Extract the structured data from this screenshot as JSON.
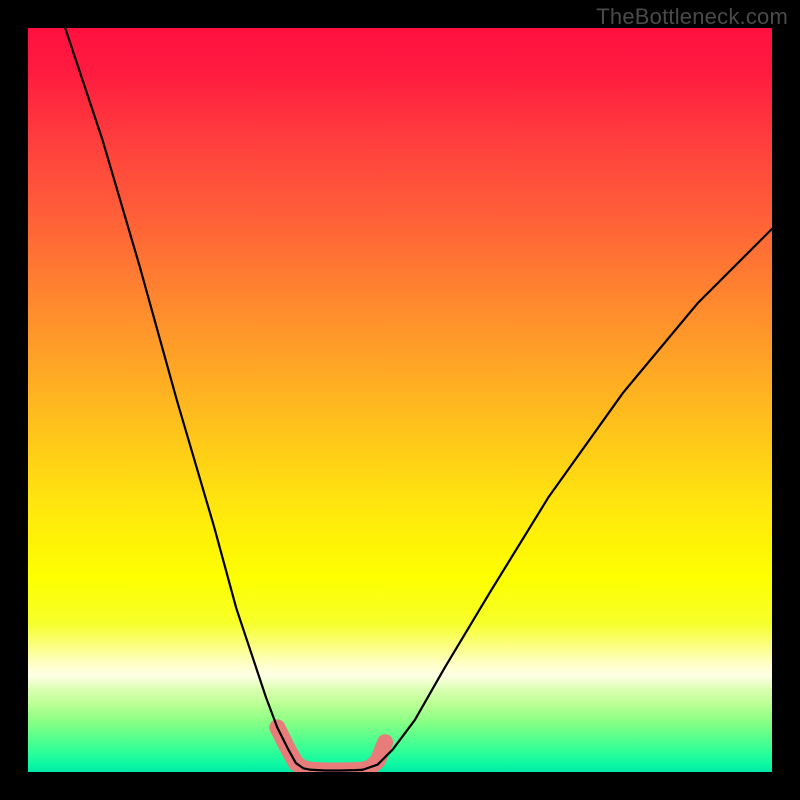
{
  "watermark": "TheBottleneck.com",
  "colors": {
    "page_bg": "#000000",
    "watermark": "#4a4a4a",
    "curve": "#000000",
    "highlight": "#e77c7a"
  },
  "chart_data": {
    "type": "line",
    "title": "",
    "xlabel": "",
    "ylabel": "",
    "xlim": [
      0,
      100
    ],
    "ylim": [
      0,
      100
    ],
    "grid": false,
    "legend": false,
    "background_gradient": "vertical red→orange→yellow→pale→green (bottleneck heatmap)",
    "series": [
      {
        "name": "bottleneck-curve-left",
        "x": [
          5,
          10,
          15,
          20,
          25,
          28,
          30,
          32,
          33.5,
          35,
          36,
          37,
          38
        ],
        "y": [
          100,
          85,
          68,
          50,
          33,
          22,
          16,
          10,
          6,
          3,
          1.2,
          0.5,
          0.3
        ]
      },
      {
        "name": "bottleneck-curve-right",
        "x": [
          45,
          47,
          49,
          52,
          56,
          62,
          70,
          80,
          90,
          100
        ],
        "y": [
          0.3,
          1,
          3,
          7,
          14,
          24,
          37,
          51,
          63,
          73
        ]
      },
      {
        "name": "optimal-floor",
        "x": [
          38,
          40,
          42,
          44,
          45
        ],
        "y": [
          0.3,
          0.2,
          0.2,
          0.25,
          0.3
        ]
      }
    ],
    "highlight_band": {
      "description": "salmon-colored thick segment marking the near-zero bottleneck region of the V-curve",
      "x": [
        33.5,
        35,
        36,
        37,
        38,
        40,
        42,
        44,
        45,
        46,
        47,
        48
      ],
      "y": [
        6,
        3,
        1.2,
        0.5,
        0.3,
        0.2,
        0.2,
        0.25,
        0.3,
        0.6,
        1.5,
        4
      ]
    }
  }
}
